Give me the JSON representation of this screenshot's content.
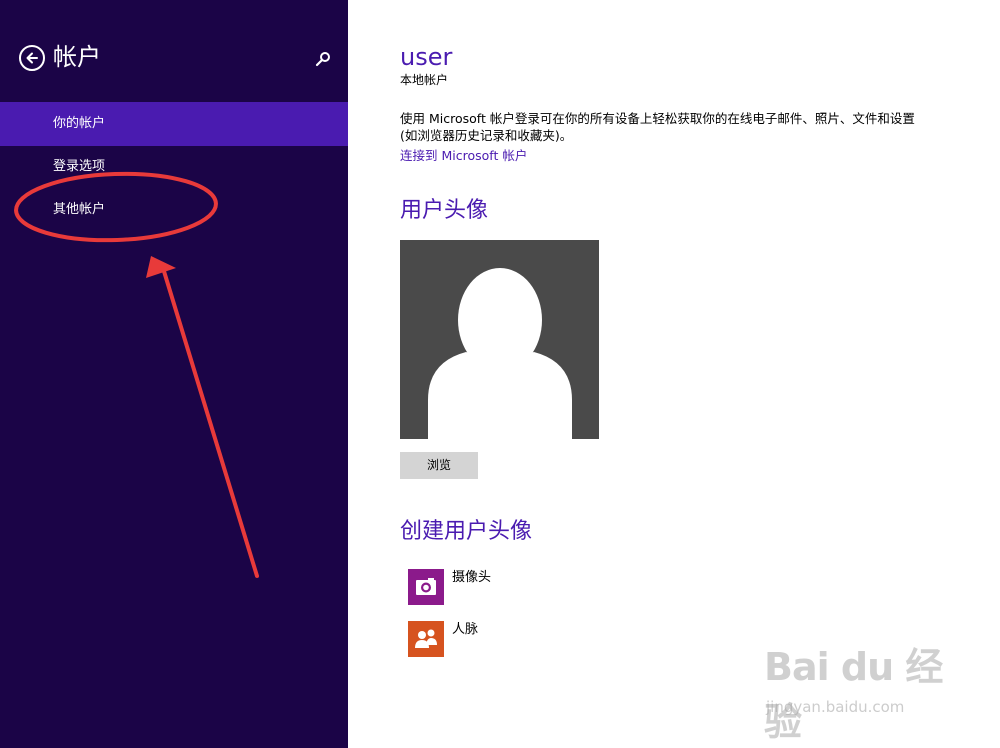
{
  "sidebar": {
    "title": "帐户",
    "items": [
      {
        "label": "你的帐户",
        "active": true
      },
      {
        "label": "登录选项",
        "active": false
      },
      {
        "label": "其他帐户",
        "active": false
      }
    ]
  },
  "main": {
    "user_name": "user",
    "account_type": "本地帐户",
    "description": "使用 Microsoft 帐户登录可在你的所有设备上轻松获取你的在线电子邮件、照片、文件和设置(如浏览器历史记录和收藏夹)。",
    "connect_link": "连接到 Microsoft 帐户",
    "avatar_section_title": "用户头像",
    "browse_label": "浏览",
    "create_section_title": "创建用户头像",
    "apps": [
      {
        "label": "摄像头",
        "icon": "camera-icon",
        "color": "#8b1a8b"
      },
      {
        "label": "人脉",
        "icon": "people-icon",
        "color": "#d6531f"
      }
    ]
  },
  "watermark": {
    "logo_text": "Bai du 经验",
    "url": "jingyan.baidu.com"
  },
  "colors": {
    "sidebar_bg": "#1b0447",
    "sidebar_active": "#4a1bb0",
    "accent": "#4a1bb0",
    "annotation_red": "#e83a3a"
  }
}
